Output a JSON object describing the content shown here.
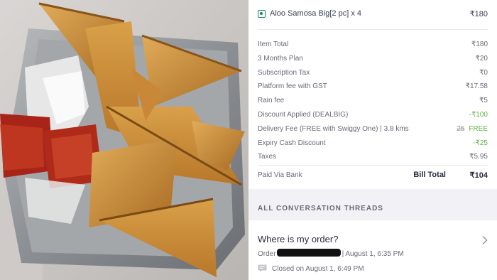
{
  "order_item": {
    "name": "Aloo Samosa Big[2 pc] x 4",
    "price": "₹180"
  },
  "bill_rows": [
    {
      "label": "Item Total",
      "value": "₹180"
    },
    {
      "label": "3 Months Plan",
      "value": "₹20"
    },
    {
      "label": "Subscription Tax",
      "value": "₹0"
    },
    {
      "label": "Platform fee with GST",
      "value": "₹17.58"
    },
    {
      "label": "Rain fee",
      "value": "₹5"
    },
    {
      "label": "Discount Applied (DEALBIG)",
      "value": "-₹100"
    },
    {
      "label": "Delivery Fee (FREE with Swiggy One) | 3.8 kms",
      "original": "25",
      "value": "FREE"
    },
    {
      "label": "Expiry Cash Discount",
      "value": "-₹25"
    },
    {
      "label": "Taxes",
      "value": "₹5.95"
    }
  ],
  "payment": {
    "paid_via": "Paid Via Bank",
    "bill_total_label": "Bill Total",
    "bill_total_value": "₹104"
  },
  "threads": {
    "header": "ALL CONVERSATION THREADS",
    "question": "Where is my order?",
    "order_prefix": "Order",
    "order_meta": "| August 1, 6:35 PM",
    "closed": "Closed on August 1, 6:49 PM"
  },
  "icons": {
    "veg": "veg-indicator-icon",
    "chevron": "chevron-right-icon",
    "chat": "chat-bubble-icon"
  },
  "colors": {
    "veg_green": "#0f8a65",
    "discount_green": "#60b246",
    "section_bg": "#f1f1f6",
    "text_dark": "#282c3f",
    "text_muted": "#686b78"
  }
}
